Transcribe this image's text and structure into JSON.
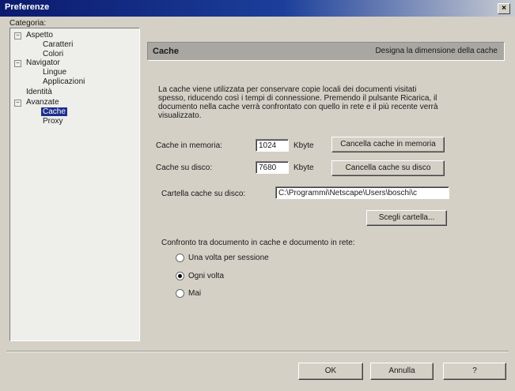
{
  "window": {
    "title": "Preferenze",
    "close_label": "×"
  },
  "category_label": "Categoria:",
  "tree": {
    "aspetto": "Aspetto",
    "caratteri": "Caratteri",
    "colori": "Colori",
    "navigator": "Navigator",
    "lingue": "Lingue",
    "applicazioni": "Applicazioni",
    "identita": "Identità",
    "avanzate": "Avanzate",
    "cache": "Cache",
    "proxy": "Proxy",
    "collapse_symbol": "−"
  },
  "panel": {
    "title": "Cache",
    "description": "Designa la dimensione della cache"
  },
  "intro": "La cache viene utilizzata per conservare copie locali dei documenti visitati spesso, riducendo così i tempi di connessione. Premendo il pulsante Ricarica, il documento nella cache verrà confrontato con quello in rete e il più recente verrà visualizzato.",
  "memory": {
    "label": "Cache in memoria:",
    "value": "1024",
    "unit": "Kbyte",
    "button": "Cancella cache in memoria"
  },
  "disk": {
    "label": "Cache su disco:",
    "value": "7680",
    "unit": "Kbyte",
    "button": "Cancella cache su disco"
  },
  "folder": {
    "label": "Cartella cache su disco:",
    "value": "C:\\Programmi\\Netscape\\Users\\boschi\\c",
    "button": "Scegli cartella..."
  },
  "compare": {
    "title": "Confronto tra documento in cache e documento in rete:",
    "options": [
      "Una volta per sessione",
      "Ogni volta",
      "Mai"
    ],
    "selected": "Ogni volta"
  },
  "buttons": {
    "ok": "OK",
    "cancel": "Annulla",
    "help": "?"
  }
}
